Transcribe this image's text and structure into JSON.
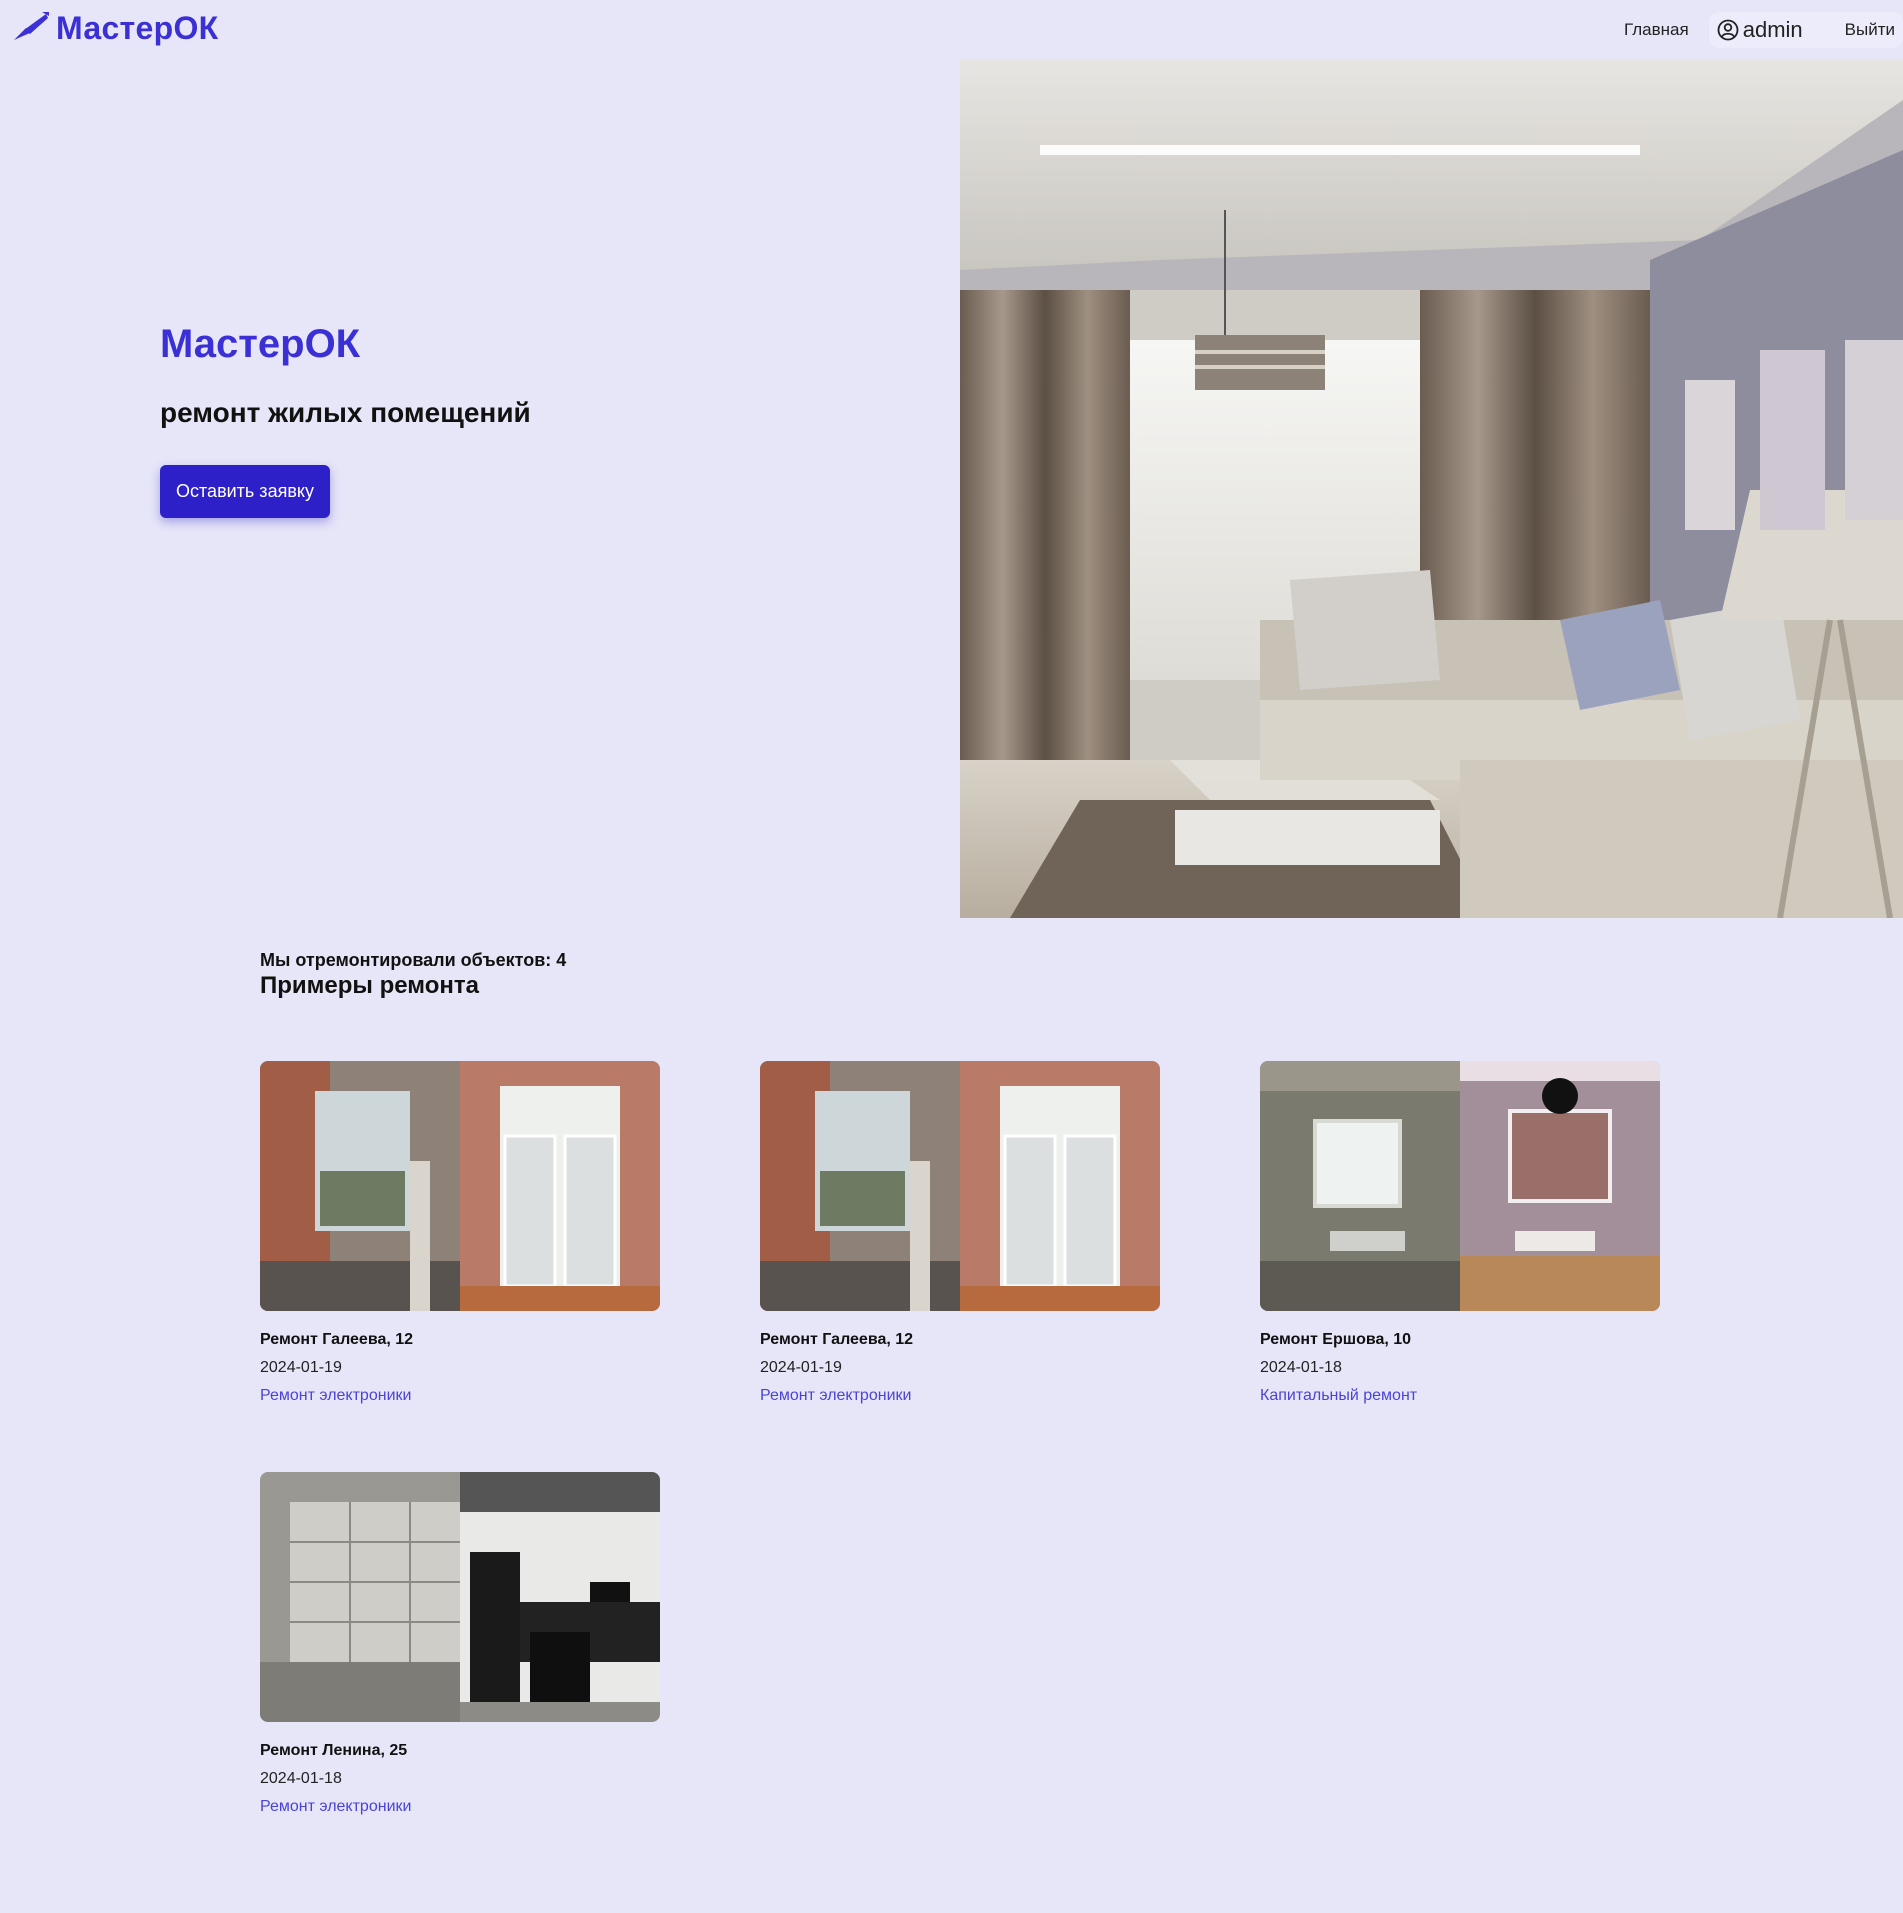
{
  "header": {
    "brand": "МастерОК",
    "nav_home": "Главная",
    "user_name": "admin",
    "logout": "Выйти"
  },
  "hero": {
    "title": "МастерОК",
    "subtitle": "ремонт жилых помещений",
    "cta": "Оставить заявку"
  },
  "portfolio": {
    "count_text": "Мы отремонтировали объектов: 4",
    "title": "Примеры ремонта",
    "items": [
      {
        "title": "Ремонт Галеева, 12",
        "date": "2024-01-19",
        "category": "Ремонт электроники"
      },
      {
        "title": "Ремонт Галеева, 12",
        "date": "2024-01-19",
        "category": "Ремонт электроники"
      },
      {
        "title": "Ремонт Ершова, 10",
        "date": "2024-01-18",
        "category": "Капитальный ремонт"
      },
      {
        "title": "Ремонт Ленина, 25",
        "date": "2024-01-18",
        "category": "Ремонт электроники"
      }
    ]
  },
  "colors": {
    "background": "#e6e6f8",
    "brand": "#3b30d6",
    "button": "#2d20c9",
    "link": "#4b43d6"
  }
}
